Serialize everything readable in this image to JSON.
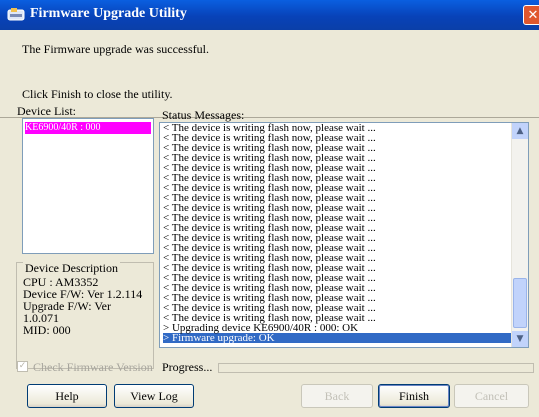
{
  "window": {
    "title": "Firmware Upgrade Utility",
    "close_glyph": "✕"
  },
  "header": {
    "message": "The Firmware upgrade was successful.",
    "instruction": "Click Finish to close the utility."
  },
  "device_list": {
    "label": "Device List:",
    "items": [
      "KE6900/40R : 000"
    ]
  },
  "device_description": {
    "title": "Device Description",
    "lines": [
      "CPU : AM3352",
      "Device F/W: Ver 1.2.114",
      "Upgrade F/W: Ver",
      "1.0.071",
      "MID: 000"
    ]
  },
  "status": {
    "label": "Status Messages:",
    "lines": [
      "< The device is writing flash now, please wait ...",
      "< The device is writing flash now, please wait ...",
      "< The device is writing flash now, please wait ...",
      "< The device is writing flash now, please wait ...",
      "< The device is writing flash now, please wait ...",
      "< The device is writing flash now, please wait ...",
      "< The device is writing flash now, please wait ...",
      "< The device is writing flash now, please wait ...",
      "< The device is writing flash now, please wait ...",
      "< The device is writing flash now, please wait ...",
      "< The device is writing flash now, please wait ...",
      "< The device is writing flash now, please wait ...",
      "< The device is writing flash now, please wait ...",
      "< The device is writing flash now, please wait ...",
      "< The device is writing flash now, please wait ...",
      "< The device is writing flash now, please wait ...",
      "< The device is writing flash now, please wait ...",
      "< The device is writing flash now, please wait ...",
      "< The device is writing flash now, please wait ...",
      "< The device is writing flash now, please wait ...",
      "> Upgrading device KE6900/40R : 000: OK",
      "> Firmware upgrade: OK"
    ],
    "selected_index": 21
  },
  "options": {
    "check_version_label": "Check Firmware Version",
    "progress_label": "Progress..."
  },
  "buttons": {
    "help": "Help",
    "view_log": "View Log",
    "back": "Back",
    "finish": "Finish",
    "cancel": "Cancel"
  },
  "colors": {
    "titlebar": "#0842b8",
    "selection": "#316ac5",
    "device_highlight": "#ff00ff",
    "close": "#e0572e"
  }
}
